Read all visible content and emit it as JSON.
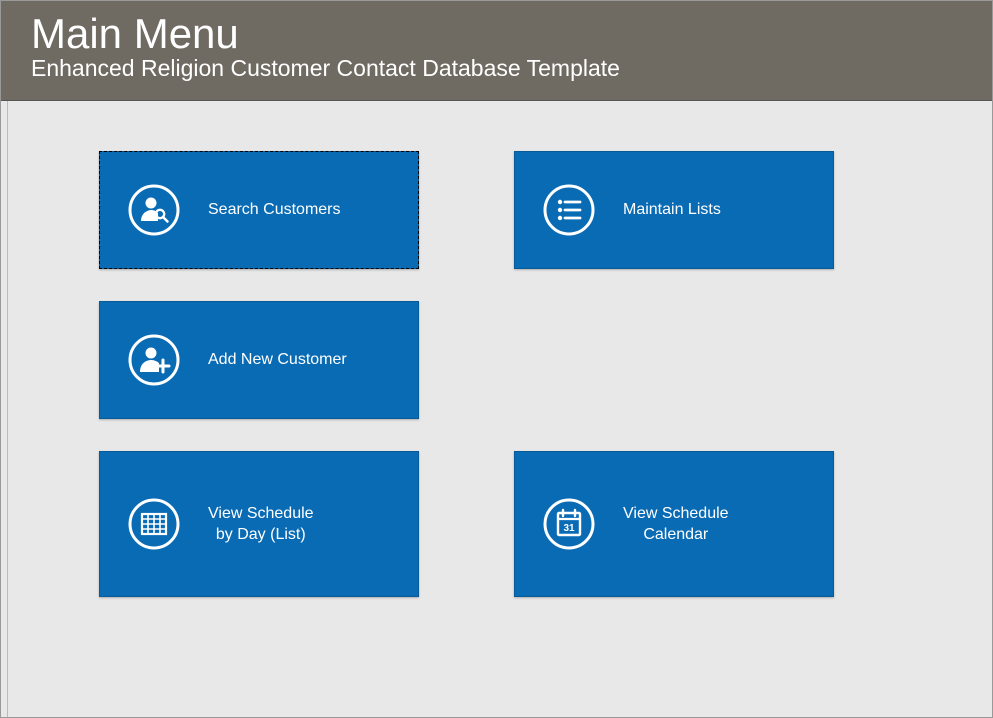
{
  "header": {
    "title": "Main Menu",
    "subtitle": "Enhanced Religion Customer Contact Database Template"
  },
  "tiles": {
    "search_customers": {
      "label": "Search Customers",
      "icon": "person-search-icon"
    },
    "maintain_lists": {
      "label": "Maintain Lists",
      "icon": "list-icon"
    },
    "add_new_customer": {
      "label": "Add New Customer",
      "icon": "person-add-icon"
    },
    "view_schedule_day": {
      "line1": "View Schedule",
      "line2": "by Day (List)",
      "icon": "grid-calendar-icon"
    },
    "view_schedule_calendar": {
      "line1": "View Schedule",
      "line2": "Calendar",
      "icon": "calendar-date-icon"
    }
  },
  "colors": {
    "header_bg": "#6f6a62",
    "tile_bg": "#0a6bb5",
    "page_bg": "#e8e8e8"
  }
}
